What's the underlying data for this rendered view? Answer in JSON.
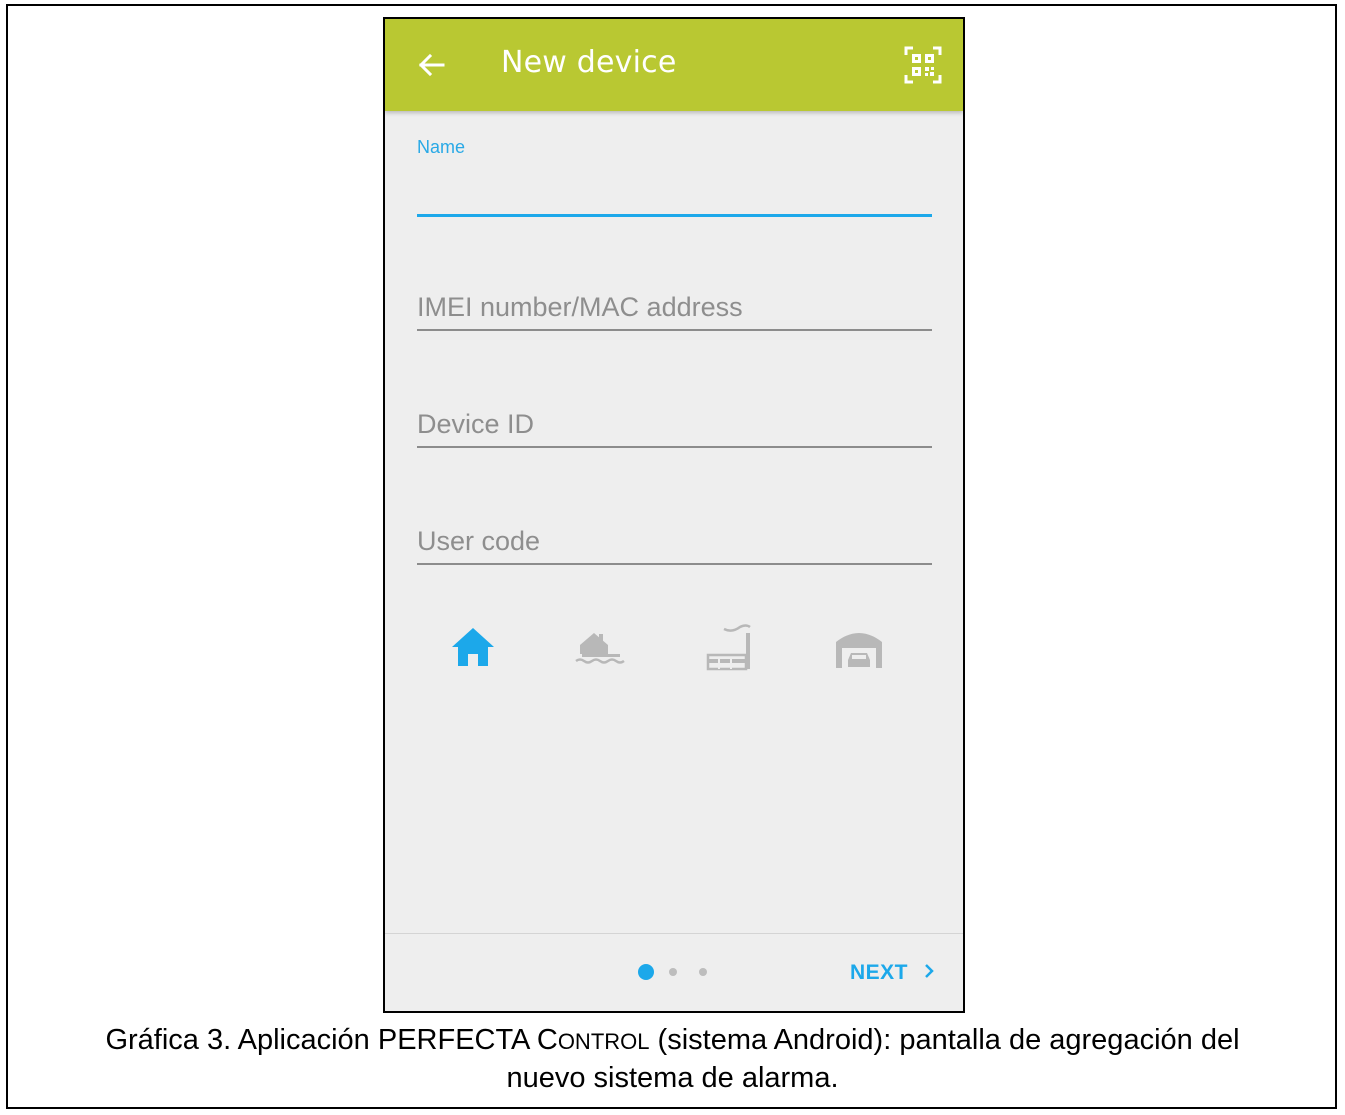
{
  "appbar": {
    "title": "New device",
    "background": "#b9c832",
    "back_icon": "arrow-left-icon",
    "qr_icon": "qr-code-scan-icon"
  },
  "form": {
    "name": {
      "label": "Name",
      "value": "",
      "placeholder": ""
    },
    "imei": {
      "placeholder": "IMEI number/MAC address",
      "value": ""
    },
    "device_id": {
      "placeholder": "Device ID",
      "value": ""
    },
    "user_code": {
      "placeholder": "User code",
      "value": ""
    }
  },
  "object_types": {
    "items": [
      {
        "icon": "house-icon",
        "selected": true
      },
      {
        "icon": "holiday-house-icon",
        "selected": false
      },
      {
        "icon": "factory-icon",
        "selected": false
      },
      {
        "icon": "garage-icon",
        "selected": false
      }
    ],
    "selected_color": "#1ca8ea",
    "unselected_color": "#b8b8b8"
  },
  "footer": {
    "pages_total": 3,
    "current_page": 1,
    "next_label": "NEXT",
    "next_icon": "chevron-right-icon",
    "accent": "#1ca8ea"
  },
  "caption": {
    "part1": "Gráfica 3. Aplicación PERFECTA C",
    "smallcaps": "ONTROL",
    "part2": " (sistema Android): pantalla de agregación del",
    "line2": "nuevo sistema de alarma."
  }
}
